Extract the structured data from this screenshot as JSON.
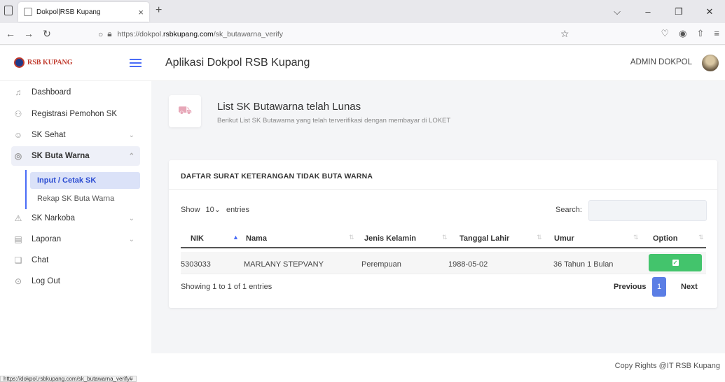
{
  "browser": {
    "tab_title": "Dokpol|RSB Kupang",
    "url_prefix": "https://dokpol.",
    "url_domain": "rsbkupang.com",
    "url_path": "/sk_butawarna_verify",
    "status_url": "https://dokpol.rsbkupang.com/sk_butawarna_verify#"
  },
  "header": {
    "logo_text": "RSB KUPANG",
    "app_title": "Aplikasi Dokpol RSB Kupang",
    "user": "ADMIN DOKPOL"
  },
  "sidebar": {
    "items": [
      {
        "label": "Dashboard",
        "icon": "bell-icon"
      },
      {
        "label": "Registrasi Pemohon SK",
        "icon": "users-icon"
      },
      {
        "label": "SK Sehat",
        "icon": "smile-icon"
      },
      {
        "label": "SK Buta Warna",
        "icon": "eye-icon"
      },
      {
        "label": "SK Narkoba",
        "icon": "warning-icon"
      },
      {
        "label": "Laporan",
        "icon": "document-icon"
      },
      {
        "label": "Chat",
        "icon": "chat-icon"
      },
      {
        "label": "Log Out",
        "icon": "logout-icon"
      }
    ],
    "sub_items": [
      {
        "label": "Input / Cetak SK"
      },
      {
        "label": "Rekap SK Buta Warna"
      }
    ]
  },
  "page": {
    "title": "List SK Butawarna telah Lunas",
    "subtitle": "Berikut List SK Butawarna yang telah terverifikasi dengan membayar di LOKET"
  },
  "card": {
    "title": "DAFTAR SURAT KETERANGAN TIDAK BUTA WARNA",
    "show_label": "Show",
    "length_value": "10",
    "entries_label": "entries",
    "search_label": "Search:",
    "search_value": "",
    "columns": [
      "NIK",
      "Nama",
      "Jenis Kelamin",
      "Tanggal Lahir",
      "Umur",
      "Option"
    ],
    "rows": [
      {
        "nik": "5303033",
        "nama": "MARLANY STEPVANY",
        "jenis_kelamin": "Perempuan",
        "tanggal_lahir": "1988-05-02",
        "umur": "36 Tahun 1 Bulan"
      }
    ],
    "info": "Showing 1 to 1 of 1 entries",
    "prev": "Previous",
    "page": "1",
    "next": "Next"
  },
  "footer": {
    "text": "Copy Rights @IT RSB Kupang"
  }
}
